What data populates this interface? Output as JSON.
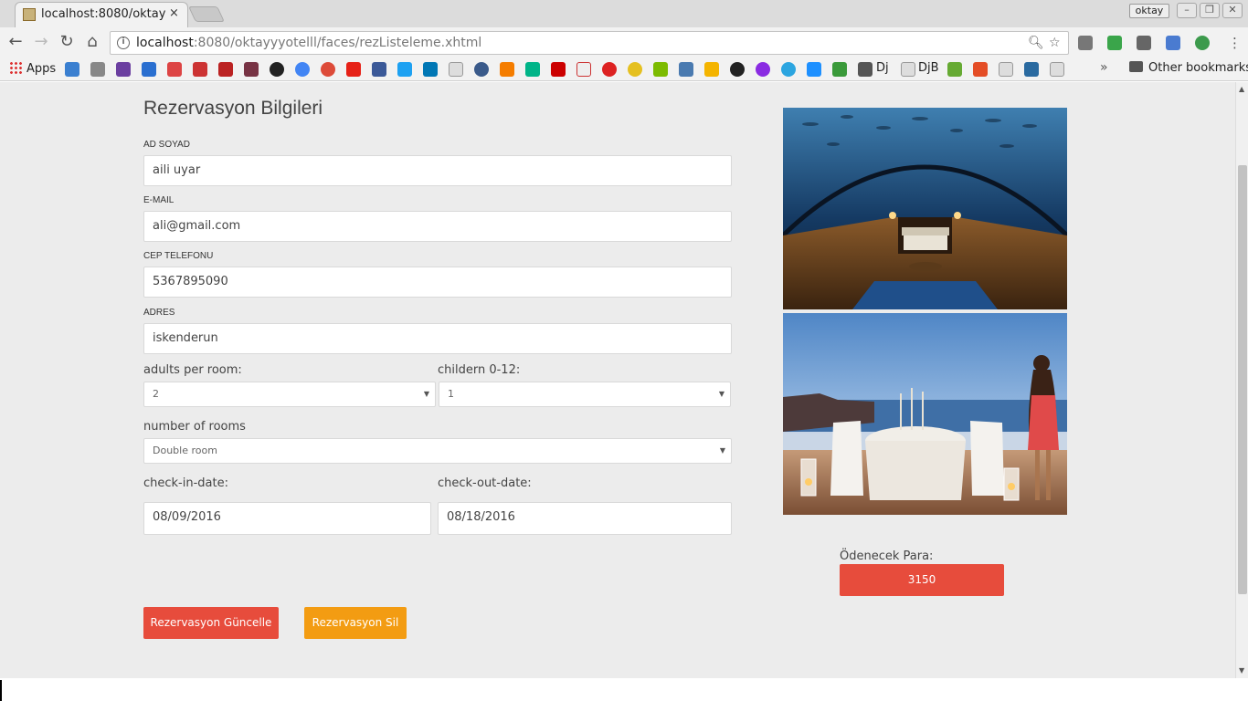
{
  "browser": {
    "tab_title": "localhost:8080/oktayyyo",
    "tab_close": "×",
    "user_name": "oktay",
    "url_host": "localhost",
    "url_rest": ":8080/oktayyyotelll/faces/rezListeleme.xhtml",
    "bookmarks": {
      "apps_label": "Apps",
      "dj_label": "Dj",
      "djb_label": "DjB",
      "overflow": "»",
      "other_label": "Other bookmarks"
    }
  },
  "form": {
    "title": "Rezervasyon Bilgileri",
    "name": {
      "label": "AD SOYAD",
      "value": "aili uyar"
    },
    "email": {
      "label": "E-MAIL",
      "value": "ali@gmail.com"
    },
    "phone": {
      "label": "CEP TELEFONU",
      "value": "5367895090"
    },
    "address": {
      "label": "ADRES",
      "value": "iskenderun"
    },
    "adults": {
      "label": "adults per room:",
      "value": "2"
    },
    "children": {
      "label": "childern 0-12:",
      "value": "1"
    },
    "rooms": {
      "label": "number of rooms",
      "value": "Double room"
    },
    "checkin": {
      "label": "check-in-date:",
      "value": "08/09/2016"
    },
    "checkout": {
      "label": "check-out-date:",
      "value": "08/18/2016"
    },
    "update_button": "Rezervasyon Güncelle",
    "delete_button": "Rezervasyon Sil"
  },
  "payment": {
    "label": "Ödenecek Para:",
    "amount": "3150"
  },
  "colors": {
    "accent_red": "#e74c3c",
    "accent_orange": "#f39c12",
    "page_bg": "#ececec"
  }
}
